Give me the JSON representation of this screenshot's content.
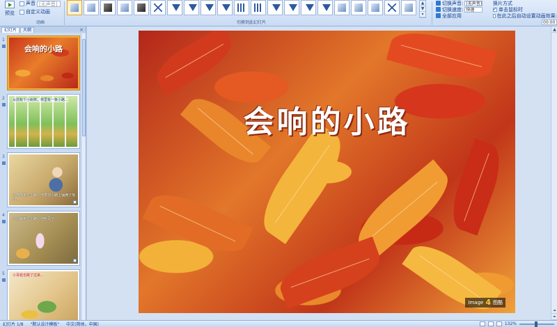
{
  "ribbon": {
    "preview_label": "预览",
    "sound_label": "声音",
    "sound_value": "[无声音]",
    "custom_anim_label": "自定义动画",
    "animation_label": "动画",
    "transition_group_label": "切换到此幻灯片",
    "transition_sound_label": "切换声音:",
    "transition_sound_value": "[无声音]",
    "transition_speed_label": "切换速度:",
    "transition_speed_value": "快速",
    "apply_all_label": "全部应用",
    "advance_label": "换片方式",
    "on_click_label": "单击鼠标时",
    "on_click_checked": true,
    "auto_after_label": "在此之后自动设置动画效果:",
    "auto_after_checked": false,
    "auto_after_value": "00:00"
  },
  "panel": {
    "tab_slides": "幻灯片",
    "tab_outline": "大纲",
    "close_glyph": "×",
    "thumbnails": [
      {
        "number": "1",
        "title": "会响的小路",
        "text": ""
      },
      {
        "number": "2",
        "title": "",
        "text": "从前有个小树林，林里有一条小路..."
      },
      {
        "number": "3",
        "title": "",
        "text": "小熊熊走过小路，他发现小路上铺满了落叶..."
      },
      {
        "number": "4",
        "title": "",
        "text": "小白兔走过小路，他听见了..."
      },
      {
        "number": "5",
        "title": "",
        "text": "小青蛙也跳了过来..."
      }
    ]
  },
  "slide": {
    "title": "会响的小路",
    "watermark_image": "Image",
    "watermark_mid": "4",
    "watermark_brand": "图酷"
  },
  "statusbar": {
    "slide_counter": "幻灯片 1/8",
    "theme": "\"默认设计模板\"",
    "language": "中文(简体，中国)",
    "zoom": "132%"
  }
}
